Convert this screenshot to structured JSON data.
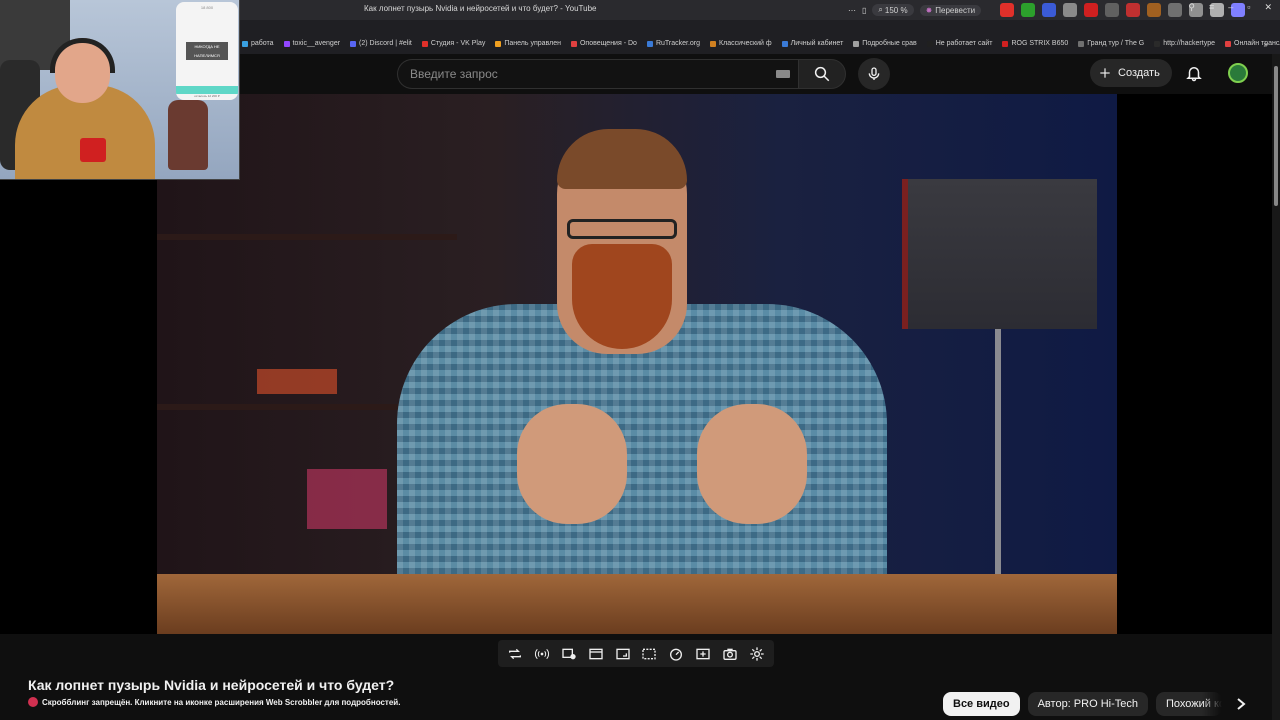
{
  "browser": {
    "tab_title": "Как лопнет пузырь Nvidia и нейросетей и что будет? - YouTube",
    "zoom": "150 %",
    "translate_label": "Перевести",
    "extension_colors": [
      "#e0302a",
      "#2ca02c",
      "#3b5bd6",
      "#8a8a8a",
      "#d02020",
      "#606060",
      "#c03030",
      "#a06020",
      "#707070",
      "#909090",
      "#b0b0b0",
      "#8080ff"
    ]
  },
  "bookmarks": {
    "items": [
      {
        "label": "работа",
        "color": "#3aa0e0"
      },
      {
        "label": "toxic__avenger",
        "color": "#9146ff"
      },
      {
        "label": "(2) Discord | #elit",
        "color": "#5865f2"
      },
      {
        "label": "Студия - VK Play",
        "color": "#e0302a"
      },
      {
        "label": "Панель управлен",
        "color": "#f0a020"
      },
      {
        "label": "Оповещения - Do",
        "color": "#e04040"
      },
      {
        "label": "RuTracker.org",
        "color": "#3a7ad6"
      },
      {
        "label": "Классический ф",
        "color": "#d08020"
      },
      {
        "label": "Личный кабинет",
        "color": "#3a7ad6"
      },
      {
        "label": "Подробные срав",
        "color": "#a0a0a0"
      },
      {
        "label": "Не работает сайт",
        "color": "#202020"
      },
      {
        "label": "ROG STRIX B650",
        "color": "#d02020"
      },
      {
        "label": "Гранд тур / The G",
        "color": "#707070"
      },
      {
        "label": "http://hackertype",
        "color": "#2a2a2a"
      },
      {
        "label": "Онлайн трансляц",
        "color": "#e04040"
      }
    ],
    "overflow_label": "»"
  },
  "youtube_header": {
    "search_placeholder": "Введите запрос",
    "create_label": "Создать"
  },
  "webcam": {
    "card_top": "18 800",
    "card_banner": "НИКОГДА НЕ НАПЕЛИМСЯ",
    "card_bottom": "осталось 12 200 Р"
  },
  "video": {
    "title": "Как лопнет пузырь Nvidia и нейросетей и что будет?",
    "scrobble_notice": "Скробблинг запрещён. Кликните на иконке расширения Web Scrobbler для подробностей."
  },
  "player_controls": {
    "icons": [
      "loop-icon",
      "audio-sync-icon",
      "playlist-play-icon",
      "cinema-icon",
      "resize-icon",
      "subtitles-icon",
      "speed-icon",
      "add-icon",
      "screenshot-icon",
      "settings-gear-icon"
    ]
  },
  "chips": {
    "items": [
      {
        "label": "Все видео",
        "active": true
      },
      {
        "label": "Автор: PRO Hi-Tech",
        "active": false
      },
      {
        "label": "Похожий ко",
        "active": false
      }
    ]
  },
  "colors": {
    "background": "#0f0f0f",
    "chip_active": "#f1f1f1",
    "chip": "#272727",
    "accent_avatar": "#7fd04f"
  }
}
